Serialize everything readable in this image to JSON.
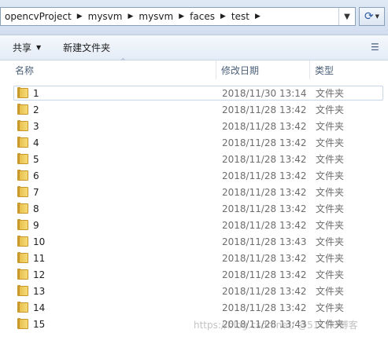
{
  "address_bar": {
    "breadcrumbs": [
      "opencvProject",
      "mysvm",
      "mysvm",
      "faces",
      "test"
    ]
  },
  "toolbar": {
    "share_label": "共享",
    "new_folder_label": "新建文件夹"
  },
  "columns": {
    "name": "名称",
    "date": "修改日期",
    "type": "类型"
  },
  "files": [
    {
      "name": "1",
      "date": "2018/11/30 13:14",
      "type": "文件夹"
    },
    {
      "name": "2",
      "date": "2018/11/28 13:42",
      "type": "文件夹"
    },
    {
      "name": "3",
      "date": "2018/11/28 13:42",
      "type": "文件夹"
    },
    {
      "name": "4",
      "date": "2018/11/28 13:42",
      "type": "文件夹"
    },
    {
      "name": "5",
      "date": "2018/11/28 13:42",
      "type": "文件夹"
    },
    {
      "name": "6",
      "date": "2018/11/28 13:42",
      "type": "文件夹"
    },
    {
      "name": "7",
      "date": "2018/11/28 13:42",
      "type": "文件夹"
    },
    {
      "name": "8",
      "date": "2018/11/28 13:42",
      "type": "文件夹"
    },
    {
      "name": "9",
      "date": "2018/11/28 13:42",
      "type": "文件夹"
    },
    {
      "name": "10",
      "date": "2018/11/28 13:43",
      "type": "文件夹"
    },
    {
      "name": "11",
      "date": "2018/11/28 13:42",
      "type": "文件夹"
    },
    {
      "name": "12",
      "date": "2018/11/28 13:42",
      "type": "文件夹"
    },
    {
      "name": "13",
      "date": "2018/11/28 13:42",
      "type": "文件夹"
    },
    {
      "name": "14",
      "date": "2018/11/28 13:42",
      "type": "文件夹"
    },
    {
      "name": "15",
      "date": "2018/11/28 13:43",
      "type": "文件夹"
    }
  ],
  "watermark": "https://blog.csdn.net/ @51CTO博客"
}
